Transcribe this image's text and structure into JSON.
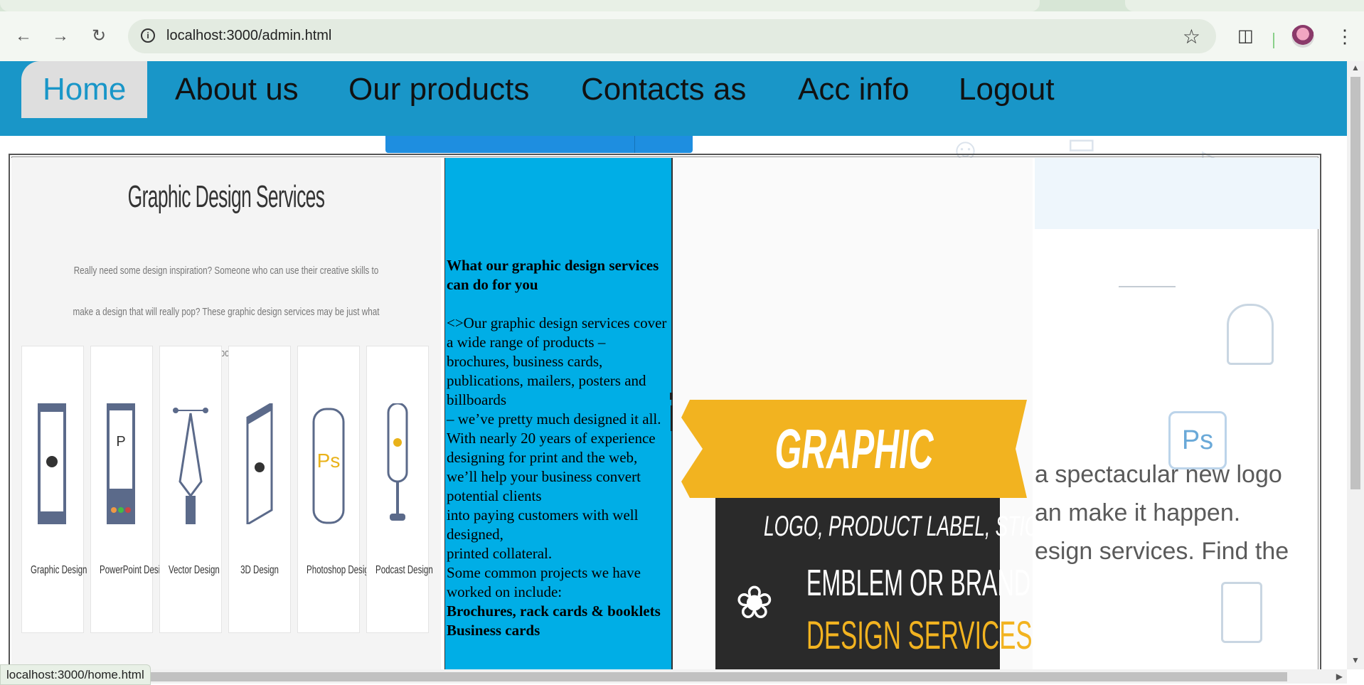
{
  "browser": {
    "url": "localhost:3000/admin.html",
    "status_url": "localhost:3000/home.html",
    "icons": {
      "back": "arrow-left-icon",
      "forward": "arrow-right-icon",
      "reload": "reload-icon",
      "info": "info-icon",
      "bookmark": "star-icon",
      "extensions": "puzzle-icon",
      "profile": "avatar",
      "menu": "kebab-menu-icon"
    }
  },
  "nav": {
    "items": [
      {
        "label": "Home",
        "active": true
      },
      {
        "label": "About us"
      },
      {
        "label": "Our products"
      },
      {
        "label": "Contacts as"
      },
      {
        "label": "Acc info"
      },
      {
        "label": "Logout"
      }
    ],
    "color": "#1996c8"
  },
  "left": {
    "title": "Graphic Design Services",
    "subtitle": "Really need some design inspiration? Someone who can use their creative skills to make a design that will really pop? These graphic design services may be just what you're looking for.",
    "cards": [
      "Graphic Design",
      "PowerPoint Design",
      "Vector Design",
      "3D Design",
      "Photoshop Design",
      "Podcast Design"
    ]
  },
  "middle": {
    "heading": "What our graphic design services can do for you",
    "paragraphs": [
      "<>Our graphic design services cover a wide range of products",
      "– brochures, business cards, publications, mailers, posters and billboards",
      "– we’ve pretty much designed it all.",
      "With nearly 20 years of experience designing for print and the web,",
      "we’ll help your business convert potential clients",
      "into paying customers with well designed,",
      "printed collateral.",
      "Some common projects we have worked on include:"
    ],
    "bold_tail": "Brochures, rack cards & booklets Business cards",
    "bg": "#00aee6"
  },
  "right": {
    "banner": "GRAPHIC DESIGN",
    "line1": "LOGO, PRODUCT LABEL, STICKER",
    "line2": "EMBLEM OR BRANDING",
    "line3": "DESIGN SERVICES",
    "banner_color": "#f2b320"
  },
  "farright": {
    "lines": [
      "a spectacular new logo",
      "an make it happen.",
      "esign services. Find the"
    ],
    "icon_label": "Ps"
  }
}
